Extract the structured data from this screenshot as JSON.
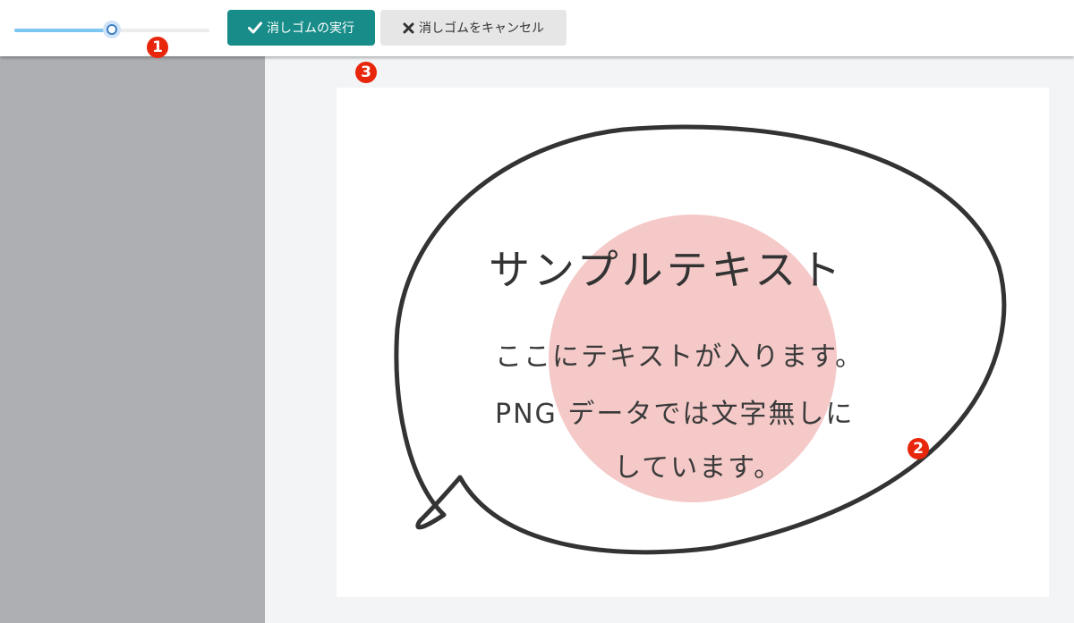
{
  "toolbar": {
    "brush_size_slider": {
      "value": 0.5
    },
    "execute_button": {
      "label": "消しゴムの実行",
      "icon": "check-icon"
    },
    "cancel_button": {
      "label": "消しゴムをキャンセル",
      "icon": "close-icon"
    }
  },
  "markers": {
    "m1": "1",
    "m2": "2",
    "m3": "3"
  },
  "canvas": {
    "title": "サンプルテキスト",
    "line1": "ここにテキストが入ります。",
    "line2": "PNG データでは文字無しに",
    "line3": "しています。"
  },
  "colors": {
    "accent": "#178c89",
    "slider_fill": "#7cc6f2",
    "marker": "#e8260c",
    "eraser_preview": "#eea8a6",
    "side_panel": "#aeafb2"
  }
}
